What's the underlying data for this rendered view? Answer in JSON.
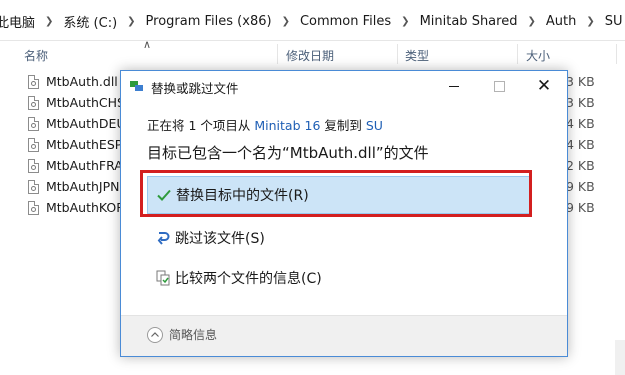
{
  "breadcrumb": [
    "此电脑",
    "系统 (C:)",
    "Program Files (x86)",
    "Common Files",
    "Minitab Shared",
    "Auth",
    "SU"
  ],
  "columns": {
    "name": "名称",
    "modified": "修改日期",
    "type": "类型",
    "size": "大小"
  },
  "files": [
    {
      "name": "MtbAuth.dll",
      "size": "3 KB"
    },
    {
      "name": "MtbAuthCHS",
      "size": "3 KB"
    },
    {
      "name": "MtbAuthDEU",
      "size": "4 KB"
    },
    {
      "name": "MtbAuthESP.",
      "size": "4 KB"
    },
    {
      "name": "MtbAuthFRA",
      "size": "2 KB"
    },
    {
      "name": "MtbAuthJPN",
      "size": "9 KB"
    },
    {
      "name": "MtbAuthKOR",
      "size": "9 KB"
    }
  ],
  "dialog": {
    "title": "替换或跳过文件",
    "info_prefix": "正在将 1 个项目从 ",
    "source": "Minitab 16",
    "info_middle": " 复制到 ",
    "destination": "SU",
    "heading": "目标已包含一个名为“MtbAuth.dll”的文件",
    "options": {
      "replace": "替换目标中的文件(R)",
      "skip": "跳过该文件(S)",
      "compare": "比较两个文件的信息(C)"
    },
    "details": "简略信息"
  },
  "colors": {
    "accent": "#4a8bd6",
    "highlight_bg": "#cce4f7",
    "highlight_border": "#99c9ef",
    "annotation_red": "#d31f1f",
    "check_green": "#2e9b3c",
    "link_blue": "#1f5fb5"
  }
}
